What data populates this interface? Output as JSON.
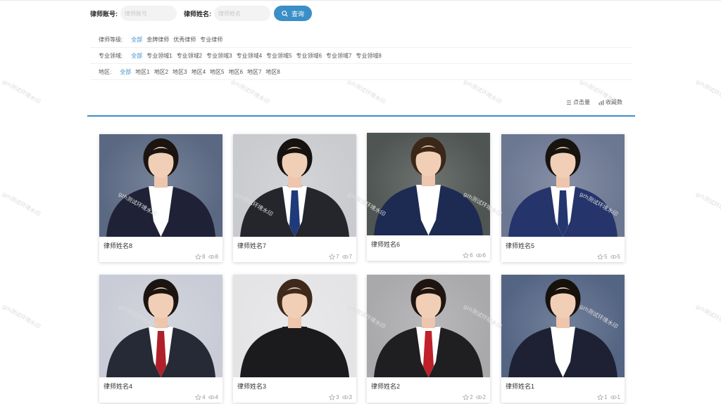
{
  "search": {
    "account_label": "律师账号:",
    "account_placeholder": "律师账号",
    "name_label": "律师姓名:",
    "name_placeholder": "律师姓名",
    "query_label": "查询"
  },
  "filters": {
    "level": {
      "label": "律师等级:",
      "options": [
        "全部",
        "金牌律师",
        "优秀律师",
        "专业律师"
      ]
    },
    "field": {
      "label": "专业领域:",
      "options": [
        "全部",
        "专业领域1",
        "专业领域2",
        "专业领域3",
        "专业领域4",
        "专业领域5",
        "专业领域6",
        "专业领域7",
        "专业领域8"
      ]
    },
    "region": {
      "label": "地区:",
      "options": [
        "全部",
        "地区1",
        "地区2",
        "地区3",
        "地区4",
        "地区5",
        "地区6",
        "地区7",
        "地区8"
      ]
    }
  },
  "sort": {
    "clicks": "点击量",
    "favorites": "收藏数"
  },
  "colors": {
    "accent": "#3b8fc7"
  },
  "lawyers": [
    {
      "name": "律师姓名8",
      "stars": "8",
      "views": "8",
      "bg": "#5a6882",
      "suit": "#1f2236",
      "shirt": "#ffffff",
      "hair": "#1b1410",
      "tie": ""
    },
    {
      "name": "律师姓名7",
      "stars": "7",
      "views": "7",
      "bg": "#c9cbcf",
      "suit": "#25262b",
      "shirt": "#ffffff",
      "hair": "#16120f",
      "tie": "#1e3a7a"
    },
    {
      "name": "律师姓名6",
      "stars": "6",
      "views": "6",
      "bg": "#4f5552",
      "suit": "#1d2a52",
      "shirt": "#ffffff",
      "hair": "#3b2718",
      "tie": ""
    },
    {
      "name": "律师姓名5",
      "stars": "5",
      "views": "5",
      "bg": "#6c7792",
      "suit": "#25346b",
      "shirt": "#ffffff",
      "hair": "#17130f",
      "tie": "#23366f"
    },
    {
      "name": "律师姓名4",
      "stars": "4",
      "views": "4",
      "bg": "#c9ccd6",
      "suit": "#262a36",
      "shirt": "#ffffff",
      "hair": "#1b1410",
      "tie": "#b0202a"
    },
    {
      "name": "律师姓名3",
      "stars": "3",
      "views": "3",
      "bg": "#e4e4e6",
      "suit": "#1b1b1d",
      "shirt": "#1b1b1d",
      "hair": "#3e2a1c",
      "tie": ""
    },
    {
      "name": "律师姓名2",
      "stars": "2",
      "views": "2",
      "bg": "#a9a9ac",
      "suit": "#1f1f22",
      "shirt": "#ffffff",
      "hair": "#1e1510",
      "tie": "#c0202a"
    },
    {
      "name": "律师姓名1",
      "stars": "1",
      "views": "1",
      "bg": "#546584",
      "suit": "#1d2133",
      "shirt": "#ffffff",
      "hair": "#17110c",
      "tie": ""
    }
  ],
  "watermark": "gzh测试环境水印"
}
